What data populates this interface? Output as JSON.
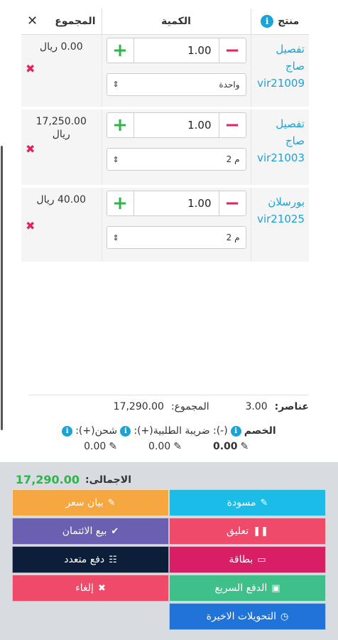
{
  "header": {
    "product": "منتج",
    "quantity": "الكمية",
    "total": "المجموع",
    "close": "✕"
  },
  "rows": [
    {
      "name": "تفصيل صاج vir21009",
      "qty": "1.00",
      "unit": "واحدة",
      "total": "0.00 ريال"
    },
    {
      "name": "تفصيل صاج vir21003",
      "qty": "1.00",
      "unit": "م 2",
      "total": "17,250.00 ريال"
    },
    {
      "name": "بورسلان vir21025",
      "qty": "1.00",
      "unit": "م 2",
      "total": "40.00 ريال"
    }
  ],
  "summary": {
    "items_label": "عناصر:",
    "items_value": "3.00",
    "sum_label": "المجموع:",
    "sum_value": "17,290.00"
  },
  "fees": {
    "discount_label": "الخصم",
    "discount_sign": "(-):",
    "discount_value": "0.00",
    "tax_label": "ضريبة الطلبية(+):",
    "tax_value": "0.00",
    "shipping_label": "شحن(+):",
    "shipping_value": "0.00"
  },
  "grand": {
    "label": "الاجمالى:",
    "value": "17,290.00"
  },
  "buttons": [
    {
      "label": "مسودة",
      "icon": "✎",
      "color": "#1bbde8",
      "name": "draft-button",
      "iconname": "edit-icon"
    },
    {
      "label": "بيان سعر",
      "icon": "✎",
      "color": "#f7a740",
      "name": "quotation-button",
      "iconname": "edit-icon"
    },
    {
      "label": "تعليق",
      "icon": "❚❚",
      "color": "#f04a6a",
      "name": "suspend-button",
      "iconname": "pause-icon"
    },
    {
      "label": "بيع الائتمان",
      "icon": "✔",
      "color": "#6a5fb0",
      "name": "credit-sale-button",
      "iconname": "check-icon"
    },
    {
      "label": "بطاقة",
      "icon": "▭",
      "color": "#d81f65",
      "name": "card-button",
      "iconname": "credit-card-icon"
    },
    {
      "label": "دفع متعدد",
      "icon": "☷",
      "color": "#0d1e3a",
      "name": "multiple-pay-button",
      "iconname": "money-list-icon"
    },
    {
      "label": "الدفع السريع",
      "icon": "▣",
      "color": "#3fc08a",
      "name": "express-checkout-button",
      "iconname": "cash-icon"
    },
    {
      "label": "إلغاء",
      "icon": "✖",
      "color": "#f04a6a",
      "name": "cancel-button",
      "iconname": "close-box-icon"
    },
    {
      "label": "التحويلات الاخيرة",
      "icon": "◷",
      "color": "#1f73d9",
      "name": "recent-transactions-button",
      "iconname": "clock-icon"
    }
  ],
  "colors": {
    "accent": "#1aa3d6",
    "plus": "#2db54b",
    "minus": "#e0245e"
  }
}
